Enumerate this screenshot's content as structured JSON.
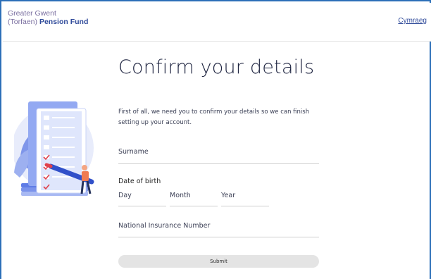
{
  "header": {
    "logo_line1": "Greater Gwent",
    "logo_line2_prefix": "(Torfaen)",
    "logo_line2_bold": "Pension Fund",
    "language_link": "Cymraeg"
  },
  "main": {
    "title": "Confirm your details",
    "intro": "First of all, we need you to confirm your details so we can finish setting up your account.",
    "fields": {
      "surname_placeholder": "Surname",
      "dob_label": "Date of birth",
      "day_placeholder": "Day",
      "month_placeholder": "Month",
      "year_placeholder": "Year",
      "ni_placeholder": "National Insurance Number"
    },
    "submit_label": "Submit"
  },
  "colors": {
    "frame_border": "#2c6fb8",
    "brand_purple": "#2f4a9a",
    "illustration_blue": "#6b87e8",
    "check_red": "#e0404a"
  }
}
